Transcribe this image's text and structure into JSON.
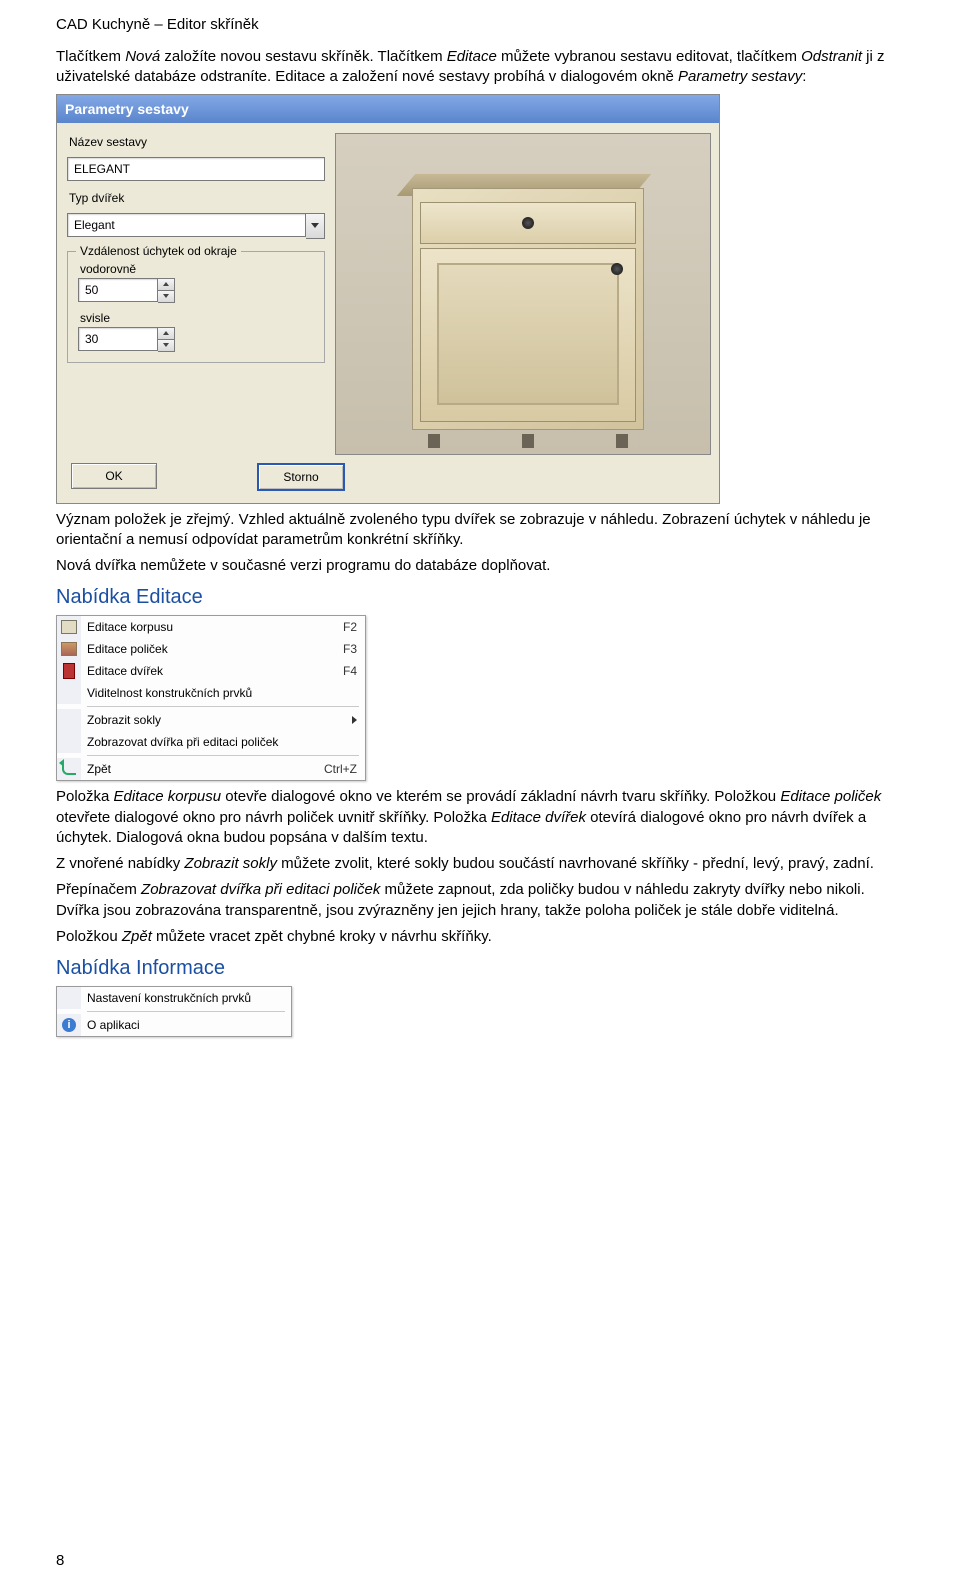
{
  "header": "CAD Kuchyně – Editor skříněk",
  "intro": {
    "p1_a": "Tlačítkem ",
    "p1_b": "Nová",
    "p1_c": " založíte novou sestavu skříněk. Tlačítkem ",
    "p1_d": "Editace",
    "p1_e": " můžete vybranou sestavu editovat, tlačítkem ",
    "p1_f": "Odstranit",
    "p1_g": " ji z uživatelské databáze odstraníte. Editace a založení nové sestavy probíhá v dialogovém okně ",
    "p1_h": "Parametry sestavy",
    "p1_i": ":"
  },
  "dialog": {
    "title": "Parametry sestavy",
    "name_label": "Název sestavy",
    "name_value": "ELEGANT",
    "type_label": "Typ dvířek",
    "type_value": "Elegant",
    "group_label": "Vzdálenost úchytek od okraje",
    "h_label": "vodorovně",
    "h_value": "50",
    "v_label": "svisle",
    "v_value": "30",
    "ok": "OK",
    "cancel": "Storno"
  },
  "mid": {
    "p1": "Význam položek je zřejmý. Vzhled aktuálně zvoleného typu dvířek se zobrazuje v náhledu. Zobrazení úchytek v náhledu je orientační a nemusí odpovídat parametrům konkrétní skříňky.",
    "p2": "Nová dvířka nemůžete v současné verzi programu do databáze doplňovat."
  },
  "h_editace": "Nabídka Editace",
  "menu_editace": {
    "items": [
      {
        "label": "Editace korpusu",
        "shortcut": "F2"
      },
      {
        "label": "Editace poliček",
        "shortcut": "F3"
      },
      {
        "label": "Editace dvířek",
        "shortcut": "F4"
      },
      {
        "label": "Viditelnost konstrukčních prvků",
        "shortcut": ""
      },
      {
        "label": "Zobrazit sokly",
        "shortcut": ""
      },
      {
        "label": "Zobrazovat dvířka při editaci poliček",
        "shortcut": ""
      },
      {
        "label": "Zpět",
        "shortcut": "Ctrl+Z"
      }
    ]
  },
  "body": {
    "p1_a": "Položka ",
    "p1_b": "Editace korpusu",
    "p1_c": " otevře dialogové okno ve kterém se provádí základní návrh tvaru skříňky. Položkou ",
    "p1_d": "Editace poliček",
    "p1_e": " otevřete dialogové okno pro návrh poliček uvnitř skříňky. Položka ",
    "p1_f": "Editace dvířek",
    "p1_g": " otevírá dialogové okno pro návrh dvířek a úchytek. Dialogová okna budou popsána v dalším textu.",
    "p2_a": "Z vnořené nabídky ",
    "p2_b": "Zobrazit sokly",
    "p2_c": " můžete zvolit, které sokly budou součástí navrhované skříňky - přední, levý, pravý, zadní.",
    "p3_a": "Přepínačem ",
    "p3_b": "Zobrazovat dvířka při editaci poliček",
    "p3_c": " můžete zapnout, zda poličky budou v náhledu zakryty dvířky nebo nikoli. Dvířka jsou zobrazována transparentně, jsou zvýrazněny jen jejich hrany, takže poloha poliček je stále dobře viditelná.",
    "p4_a": "Položkou ",
    "p4_b": "Zpět",
    "p4_c": " můžete vracet zpět chybné kroky v návrhu skříňky."
  },
  "h_info": "Nabídka Informace",
  "menu_info": {
    "item1": "Nastavení konstrukčních prvků",
    "item2": "O aplikaci"
  },
  "page_number": "8"
}
